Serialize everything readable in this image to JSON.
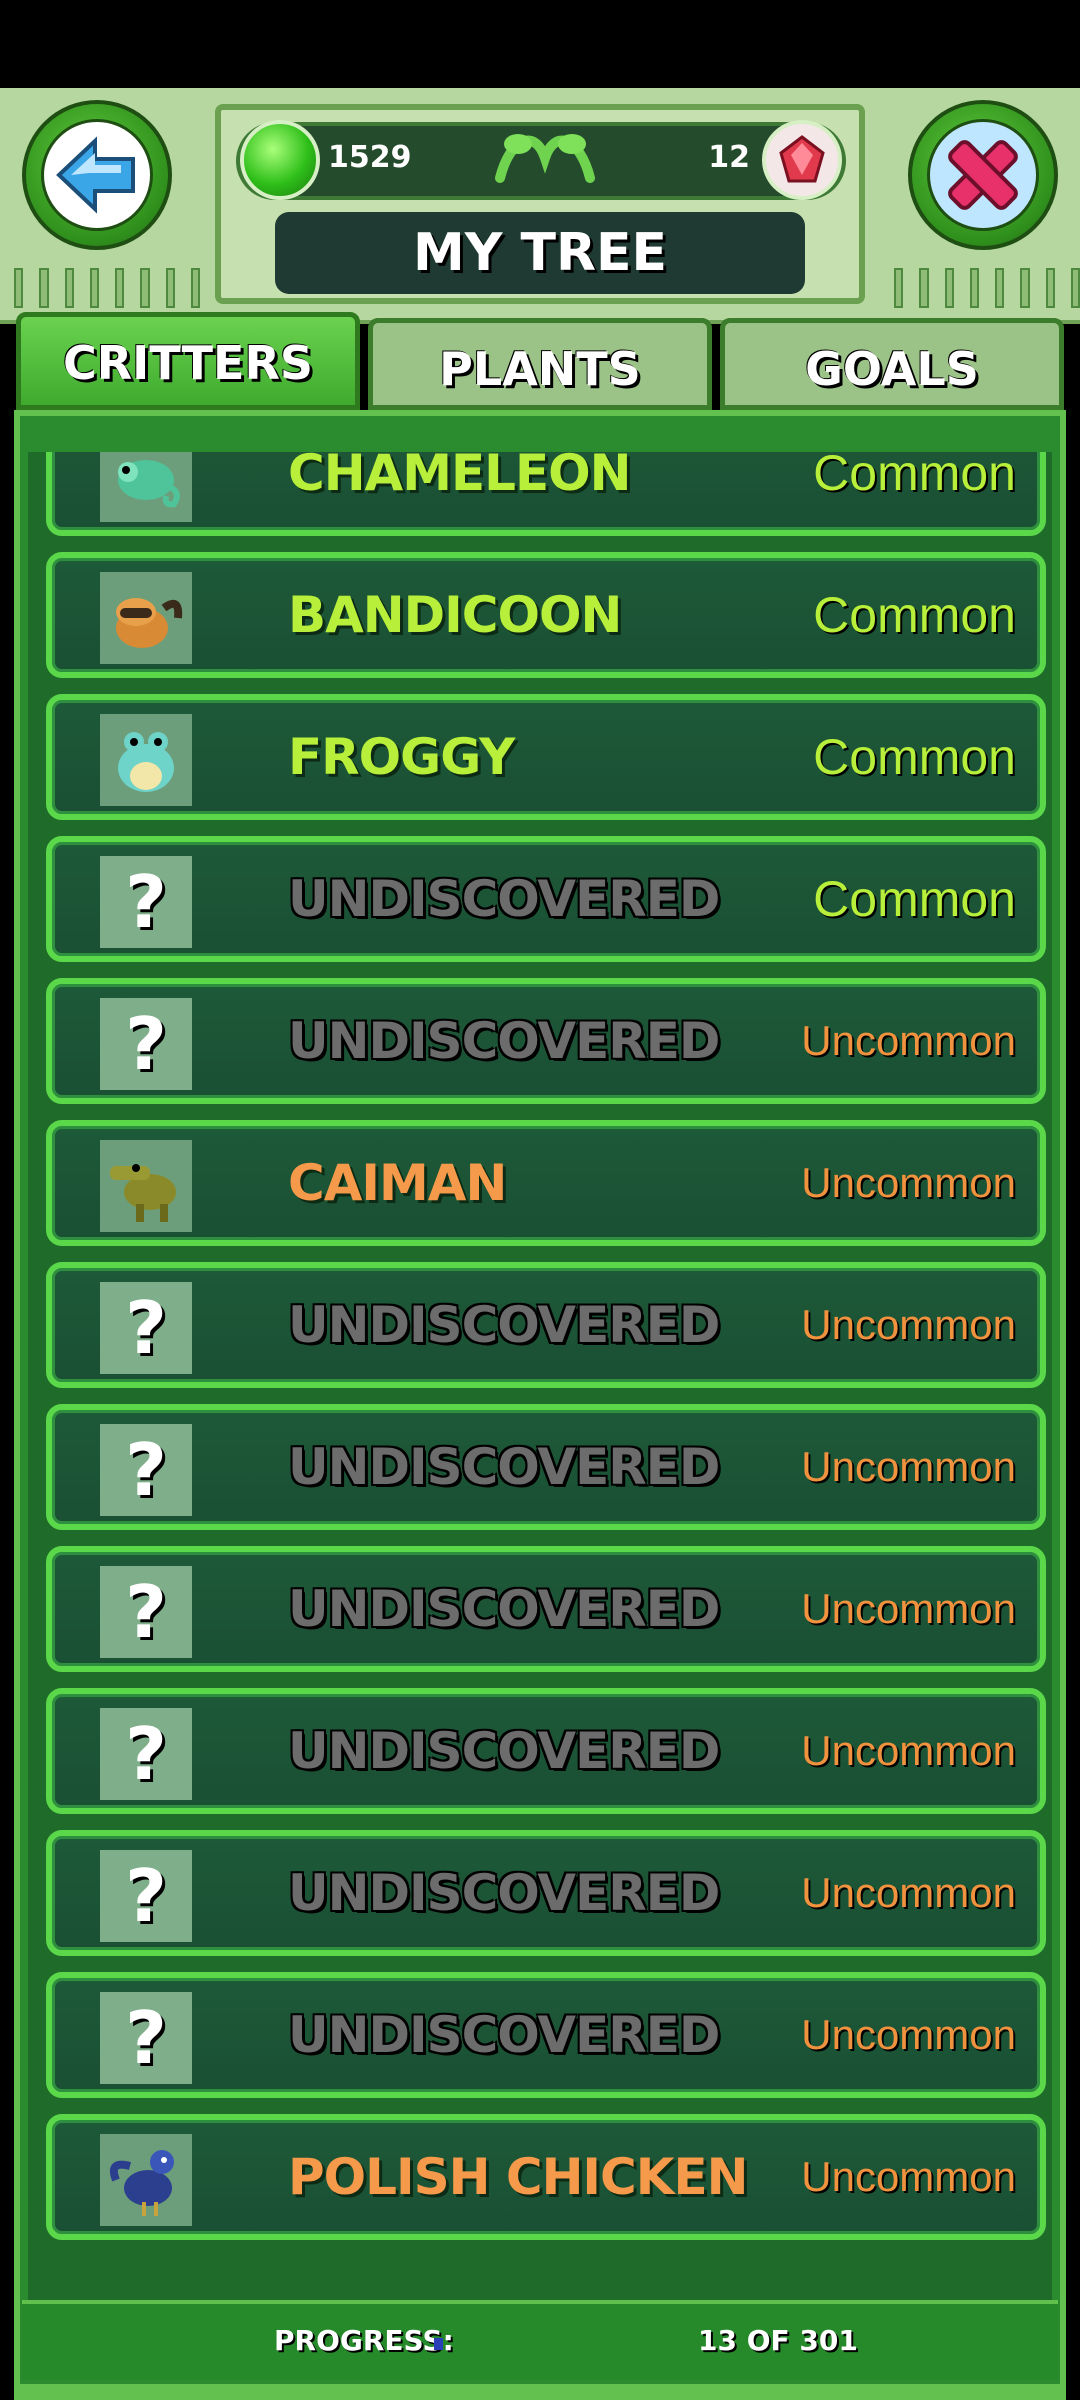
{
  "header": {
    "title": "MY TREE",
    "green_gems": "1529",
    "red_gems": "12",
    "back_icon": "back-arrow-icon",
    "close_icon": "close-x-icon"
  },
  "tabs": [
    {
      "label": "CRITTERS",
      "active": true
    },
    {
      "label": "PLANTS",
      "active": false
    },
    {
      "label": "GOALS",
      "active": false
    }
  ],
  "rows": [
    {
      "name": "CHAMELEON",
      "rarity": "Common",
      "discovered": true,
      "icon": "chameleon"
    },
    {
      "name": "BANDICOON",
      "rarity": "Common",
      "discovered": true,
      "icon": "bandicoon"
    },
    {
      "name": "FROGGY",
      "rarity": "Common",
      "discovered": true,
      "icon": "froggy"
    },
    {
      "name": "UNDISCOVERED",
      "rarity": "Common",
      "discovered": false,
      "icon": "question-mark"
    },
    {
      "name": "UNDISCOVERED",
      "rarity": "Uncommon",
      "discovered": false,
      "icon": "question-mark"
    },
    {
      "name": "CAIMAN",
      "rarity": "Uncommon",
      "discovered": true,
      "icon": "caiman"
    },
    {
      "name": "UNDISCOVERED",
      "rarity": "Uncommon",
      "discovered": false,
      "icon": "question-mark"
    },
    {
      "name": "UNDISCOVERED",
      "rarity": "Uncommon",
      "discovered": false,
      "icon": "question-mark"
    },
    {
      "name": "UNDISCOVERED",
      "rarity": "Uncommon",
      "discovered": false,
      "icon": "question-mark"
    },
    {
      "name": "UNDISCOVERED",
      "rarity": "Uncommon",
      "discovered": false,
      "icon": "question-mark"
    },
    {
      "name": "UNDISCOVERED",
      "rarity": "Uncommon",
      "discovered": false,
      "icon": "question-mark"
    },
    {
      "name": "UNDISCOVERED",
      "rarity": "Uncommon",
      "discovered": false,
      "icon": "question-mark"
    },
    {
      "name": "POLISH CHICKEN",
      "rarity": "Uncommon",
      "discovered": true,
      "icon": "polish-chicken"
    }
  ],
  "progress": {
    "label": "PROGRESS:",
    "count": "13 OF 301",
    "fraction": 0.0432
  },
  "colors": {
    "common": "#b7ef3a",
    "uncommon": "#f0923e",
    "undiscovered": "#6c6c6c"
  }
}
